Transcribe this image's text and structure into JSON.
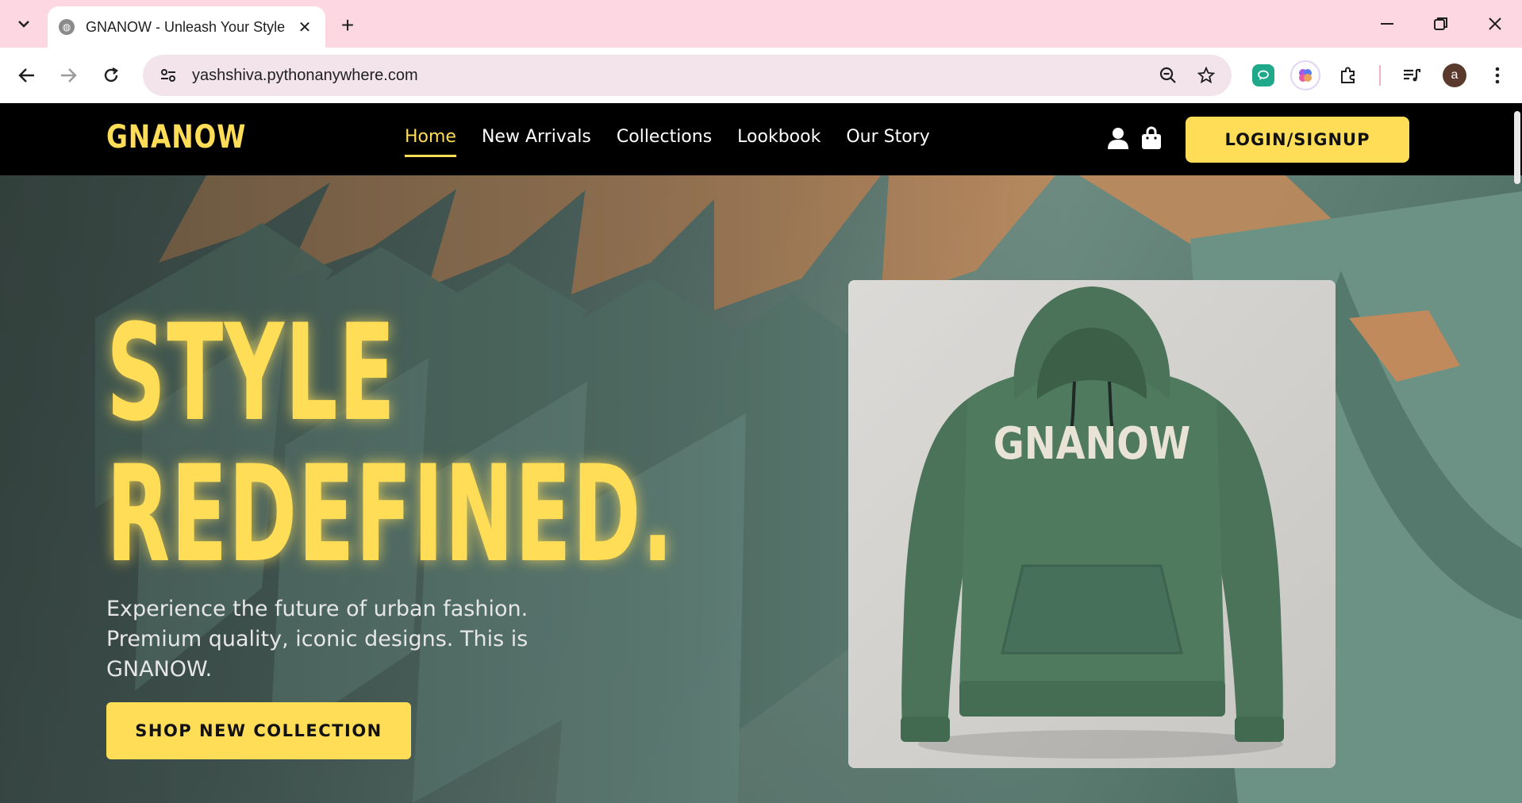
{
  "browser": {
    "tab_title": "GNANOW - Unleash Your Style",
    "url": "yashshiva.pythonanywhere.com",
    "profile_initial": "a"
  },
  "site": {
    "logo": "GNANOW",
    "nav": [
      {
        "label": "Home",
        "active": true
      },
      {
        "label": "New Arrivals",
        "active": false
      },
      {
        "label": "Collections",
        "active": false
      },
      {
        "label": "Lookbook",
        "active": false
      },
      {
        "label": "Our Story",
        "active": false
      }
    ],
    "login_label": "LOGIN/SIGNUP",
    "icons": [
      "user-icon",
      "shopping-bag-icon"
    ]
  },
  "hero": {
    "headline_line1": "STYLE",
    "headline_line2": "REDEFINED.",
    "tagline": "Experience the future of urban fashion. Premium quality, iconic designs. This is GNANOW.",
    "cta_label": "SHOP NEW COLLECTION",
    "product_print": "GNANOW"
  },
  "colors": {
    "accent": "#ffdd57",
    "header_bg": "#000000",
    "tabstrip_bg": "#fdd7e2",
    "hoodie_green": "#4f7a5e"
  }
}
